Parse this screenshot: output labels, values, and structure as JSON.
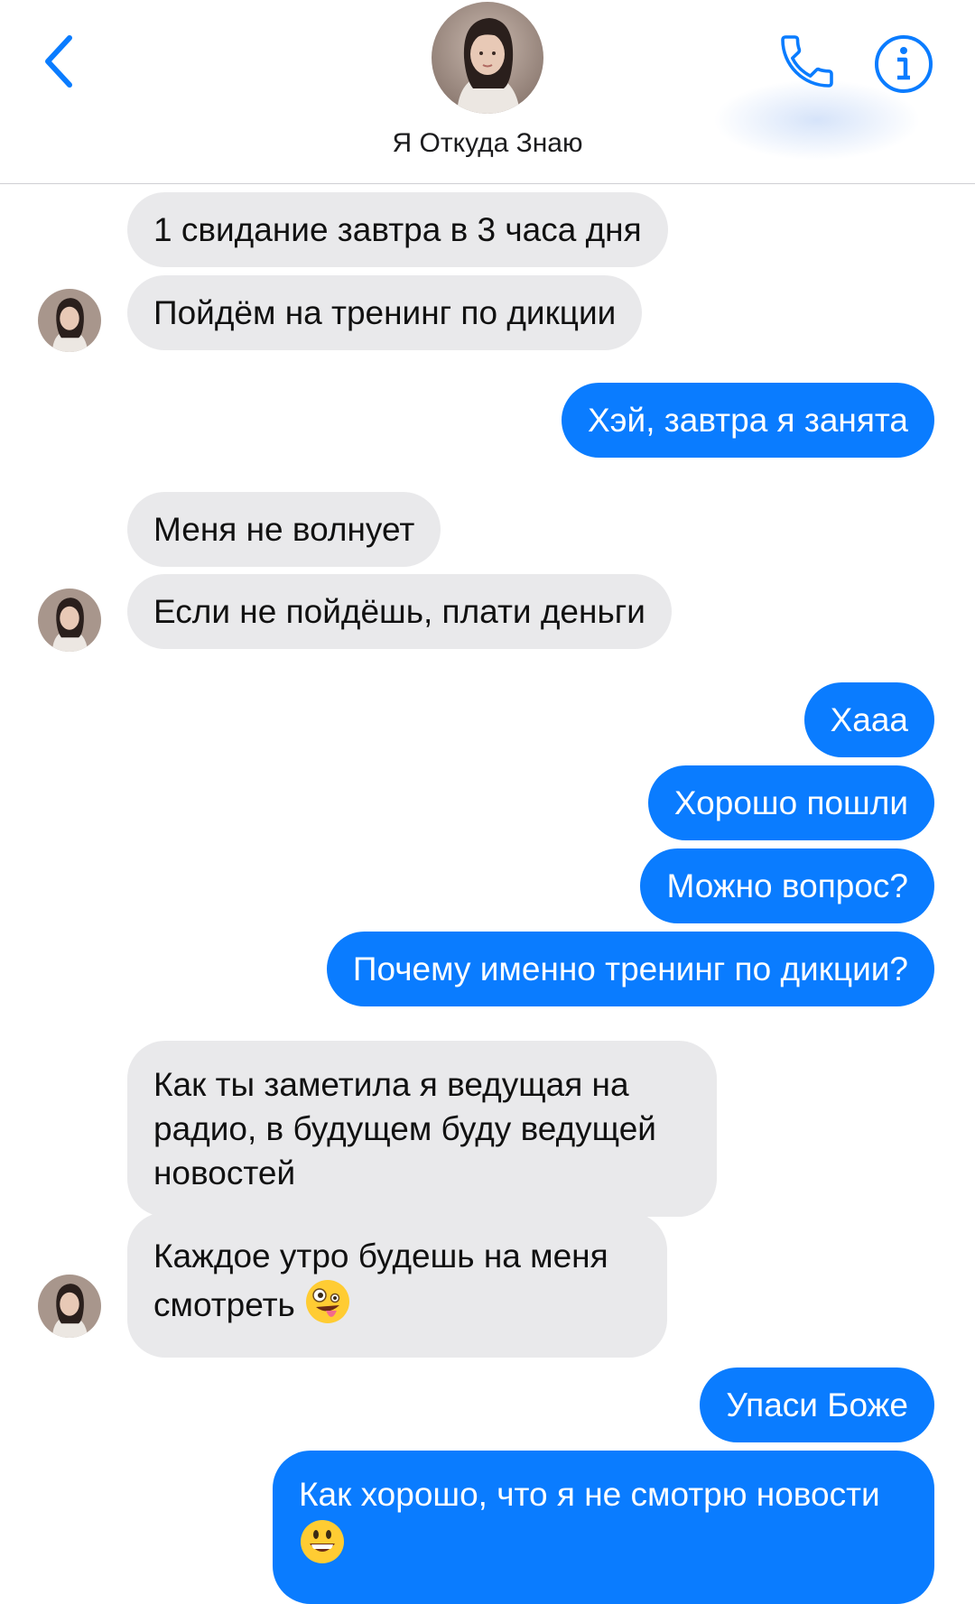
{
  "header": {
    "contact_name": "Я Откуда Знаю"
  },
  "icons": {
    "back": "chevron-left-icon",
    "call": "phone-icon",
    "info": "info-icon"
  },
  "colors": {
    "accent": "#0a7cff",
    "incoming_bubble": "#e9e9eb"
  },
  "messages": [
    {
      "from": "them",
      "text": "1 свидание завтра в 3 часа дня"
    },
    {
      "from": "them",
      "text": "Пойдём на тренинг по дикции"
    },
    {
      "from": "me",
      "text": "Хэй, завтра я занята"
    },
    {
      "from": "them",
      "text": "Меня не волнует"
    },
    {
      "from": "them",
      "text": "Если не пойдёшь, плати деньги"
    },
    {
      "from": "me",
      "text": "Хааа"
    },
    {
      "from": "me",
      "text": "Хорошо пошли"
    },
    {
      "from": "me",
      "text": "Можно вопрос?"
    },
    {
      "from": "me",
      "text": "Почему именно тренинг по дикции?"
    },
    {
      "from": "them",
      "text": "Как ты заметила я ведущая на радио, в будущем буду ведущей новостей"
    },
    {
      "from": "them",
      "text": "Каждое утро будешь на меня смотреть",
      "emoji": "zany-face-emoji"
    },
    {
      "from": "me",
      "text": "Упаси Боже"
    },
    {
      "from": "me",
      "text": "Как хорошо, что я не смотрю новости",
      "emoji": "grinning-face-emoji"
    }
  ]
}
